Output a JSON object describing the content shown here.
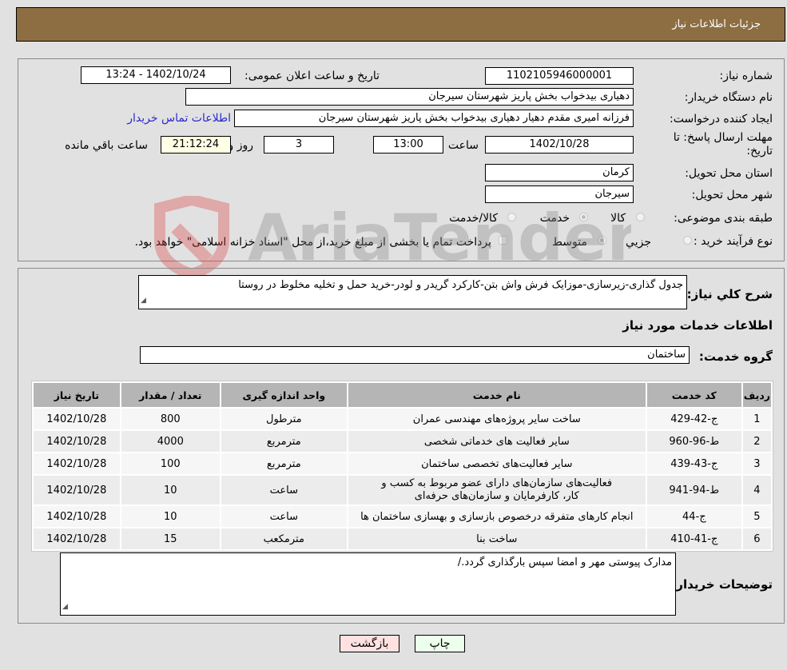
{
  "header": {
    "title": "جزئیات اطلاعات نیاز"
  },
  "info": {
    "need_number_label": "شماره نیاز:",
    "need_number": "1102105946000001",
    "announce_label": "تاریخ و ساعت اعلان عمومی:",
    "announce_value": "1402/10/24 - 13:24",
    "buyer_org_label": "نام دستگاه خریدار:",
    "buyer_org": "دهیاری بیدخواب بخش پاریز شهرستان سیرجان",
    "creator_label": "ایجاد کننده درخواست:",
    "creator": "فرزانه امیری مقدم دهیار دهیاری بیدخواب بخش پاریز شهرستان سیرجان",
    "contact_link": "اطلاعات تماس خریدار",
    "deadline_label_1": "مهلت ارسال پاسخ: تا",
    "deadline_label_2": "تاریخ:",
    "deadline_date": "1402/10/28",
    "time_label": "ساعت",
    "deadline_time": "13:00",
    "days_value": "3",
    "days_label": "روز و",
    "remaining_time": "21:12:24",
    "remaining_label": "ساعت باقي مانده",
    "province_label": "استان محل تحویل:",
    "province": "کرمان",
    "city_label": "شهر محل تحویل:",
    "city": "سیرجان",
    "category_label": "طبقه بندی موضوعی:",
    "category_options": [
      "کالا",
      "خدمت",
      "کالا/خدمت"
    ],
    "category_selected": "خدمت",
    "process_label": "نوع فرآیند خرید :",
    "process_options": [
      "جزیي",
      "متوسط"
    ],
    "process_selected": "متوسط",
    "treasury_note": "پرداخت تمام یا بخشی از مبلغ خرید،از محل \"اسناد خزانه اسلامی\" خواهد بود."
  },
  "details": {
    "summary_label": "شرح کلي نیاز:",
    "summary": "جدول گذاری-زیرسازی-موزایک فرش واش بتن-کارکرد گریدر و لودر-خرید حمل و تخلیه مخلوط در روستا",
    "services_title": "اطلاعات خدمات مورد نیاز",
    "service_group_label": "گروه خدمت:",
    "service_group": "ساختمان",
    "table": {
      "headers": [
        "ردیف",
        "کد خدمت",
        "نام خدمت",
        "واحد اندازه گیری",
        "تعداد / مقدار",
        "تاریخ نیاز"
      ],
      "rows": [
        [
          "1",
          "ج-42-429",
          "ساخت سایر پروژه‌های مهندسی عمران",
          "مترطول",
          "800",
          "1402/10/28"
        ],
        [
          "2",
          "ط-96-960",
          "سایر فعالیت های خدماتی شخصی",
          "مترمربع",
          "4000",
          "1402/10/28"
        ],
        [
          "3",
          "ج-43-439",
          "سایر فعالیت‌های تخصصی ساختمان",
          "مترمربع",
          "100",
          "1402/10/28"
        ],
        [
          "4",
          "ط-94-941",
          "فعالیت‌های سازمان‌های دارای عضو مربوط به کسب و کار، کارفرمایان و سازمان‌های حرفه‌ای",
          "ساعت",
          "10",
          "1402/10/28"
        ],
        [
          "5",
          "ج-44",
          "انجام کارهای متفرقه درخصوص بازسازی و بهسازی ساختمان ها",
          "ساعت",
          "10",
          "1402/10/28"
        ],
        [
          "6",
          "ج-41-410",
          "ساخت بنا",
          "مترمکعب",
          "15",
          "1402/10/28"
        ]
      ]
    },
    "buyer_notes_label": "توضیحات خریدار:",
    "buyer_notes": "مدارک پیوستی مهر و امضا سپس بارگذاری گردد./"
  },
  "buttons": {
    "print": "چاپ",
    "back": "بازگشت"
  },
  "colors": {
    "header_bg": "#8d6e43",
    "print_bg": "#ecffec",
    "back_bg": "#ffe1e1",
    "link": "#2a2ad0"
  }
}
